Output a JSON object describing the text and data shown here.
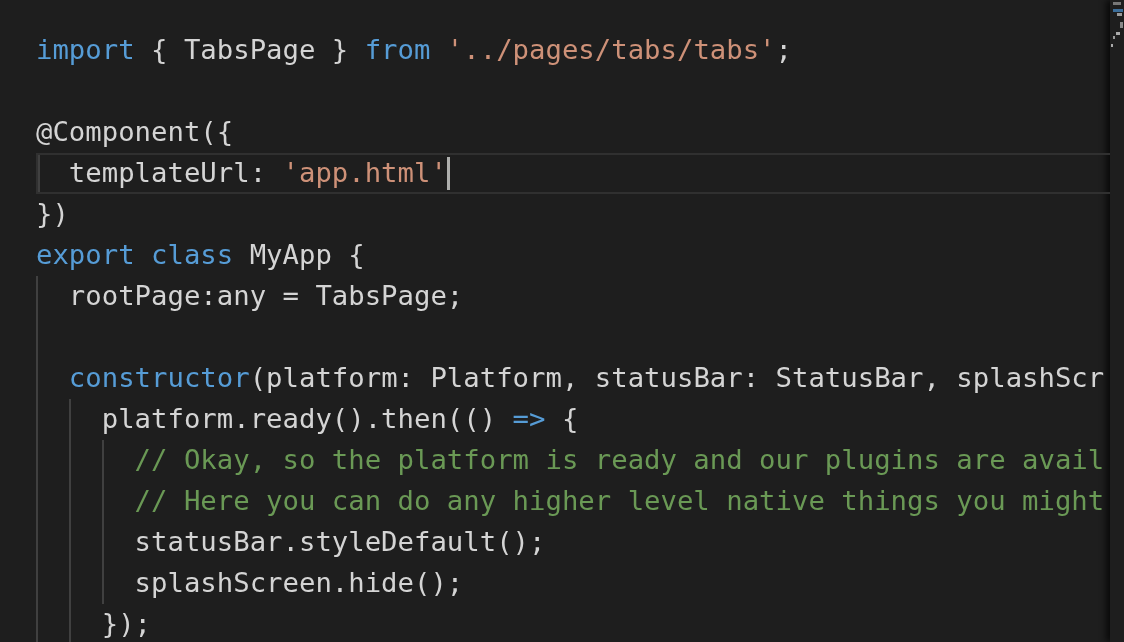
{
  "editor": {
    "lines": [
      {
        "current": false,
        "tokens": [
          {
            "kind": "keyword",
            "text": "import"
          },
          {
            "kind": "plain",
            "text": " { TabsPage } "
          },
          {
            "kind": "keyword",
            "text": "from"
          },
          {
            "kind": "string",
            "text": " '../pages/tabs/tabs'"
          },
          {
            "kind": "plain",
            "text": ";"
          }
        ]
      },
      {
        "current": false
      },
      {
        "current": false,
        "tokens": [
          {
            "kind": "plain",
            "text": "@Component({"
          }
        ]
      },
      {
        "current": true,
        "tokens": [
          {
            "kind": "plain",
            "text": "  templateUrl: "
          },
          {
            "kind": "string",
            "text": "'app.html'"
          }
        ]
      },
      {
        "current": false,
        "tokens": [
          {
            "kind": "plain",
            "text": "})"
          }
        ]
      },
      {
        "current": false,
        "tokens": [
          {
            "kind": "keyword",
            "text": "export"
          },
          {
            "kind": "keyword",
            "text": " class"
          },
          {
            "kind": "plain",
            "text": " MyApp {"
          }
        ]
      },
      {
        "current": false,
        "tokens": [
          {
            "kind": "plain",
            "text": "  rootPage:any = TabsPage;"
          }
        ]
      },
      {
        "current": false
      },
      {
        "current": false,
        "tokens": [
          {
            "kind": "keyword",
            "text": "  constructor"
          },
          {
            "kind": "plain",
            "text": "(platform: Platform, statusBar: StatusBar, splashScr"
          }
        ]
      },
      {
        "current": false,
        "tokens": [
          {
            "kind": "plain",
            "text": "    platform.ready().then(() "
          },
          {
            "kind": "keyword",
            "text": "=>"
          },
          {
            "kind": "plain",
            "text": " {"
          }
        ]
      },
      {
        "current": false,
        "tokens": [
          {
            "kind": "comment",
            "text": "      // Okay, so the platform is ready and our plugins are avail"
          }
        ]
      },
      {
        "current": false,
        "tokens": [
          {
            "kind": "comment",
            "text": "      // Here you can do any higher level native things you might"
          }
        ]
      },
      {
        "current": false,
        "tokens": [
          {
            "kind": "plain",
            "text": "      statusBar.styleDefault();"
          }
        ]
      },
      {
        "current": false,
        "tokens": [
          {
            "kind": "plain",
            "text": "      splashScreen.hide();"
          }
        ]
      },
      {
        "current": false,
        "tokens": [
          {
            "kind": "plain",
            "text": "    });"
          }
        ]
      }
    ]
  }
}
